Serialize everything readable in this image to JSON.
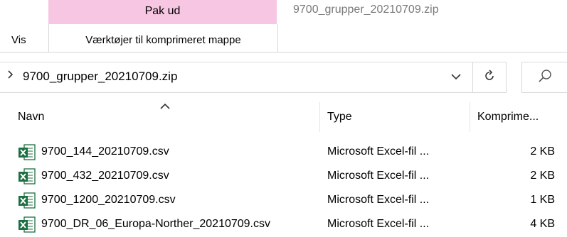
{
  "ribbon": {
    "context_tab_label": "Pak ud",
    "window_title": "9700_grupper_20210709.zip",
    "tabs": [
      {
        "label": "Vis"
      },
      {
        "label": "Værktøjer til komprimeret mappe"
      }
    ]
  },
  "address_bar": {
    "path": "9700_grupper_20210709.zip"
  },
  "columns": {
    "name": "Navn",
    "type": "Type",
    "compressed": "Komprime..."
  },
  "files": [
    {
      "name": "9700_144_20210709.csv",
      "type": "Microsoft Excel-fil ...",
      "size": "2 KB"
    },
    {
      "name": "9700_432_20210709.csv",
      "type": "Microsoft Excel-fil ...",
      "size": "2 KB"
    },
    {
      "name": "9700_1200_20210709.csv",
      "type": "Microsoft Excel-fil ...",
      "size": "1 KB"
    },
    {
      "name": "9700_DR_06_Europa-Norther_20210709.csv",
      "type": "Microsoft Excel-fil ...",
      "size": "4 KB"
    }
  ],
  "colors": {
    "context_tab": "#f7c6e2",
    "excel_green": "#1d6f42"
  }
}
